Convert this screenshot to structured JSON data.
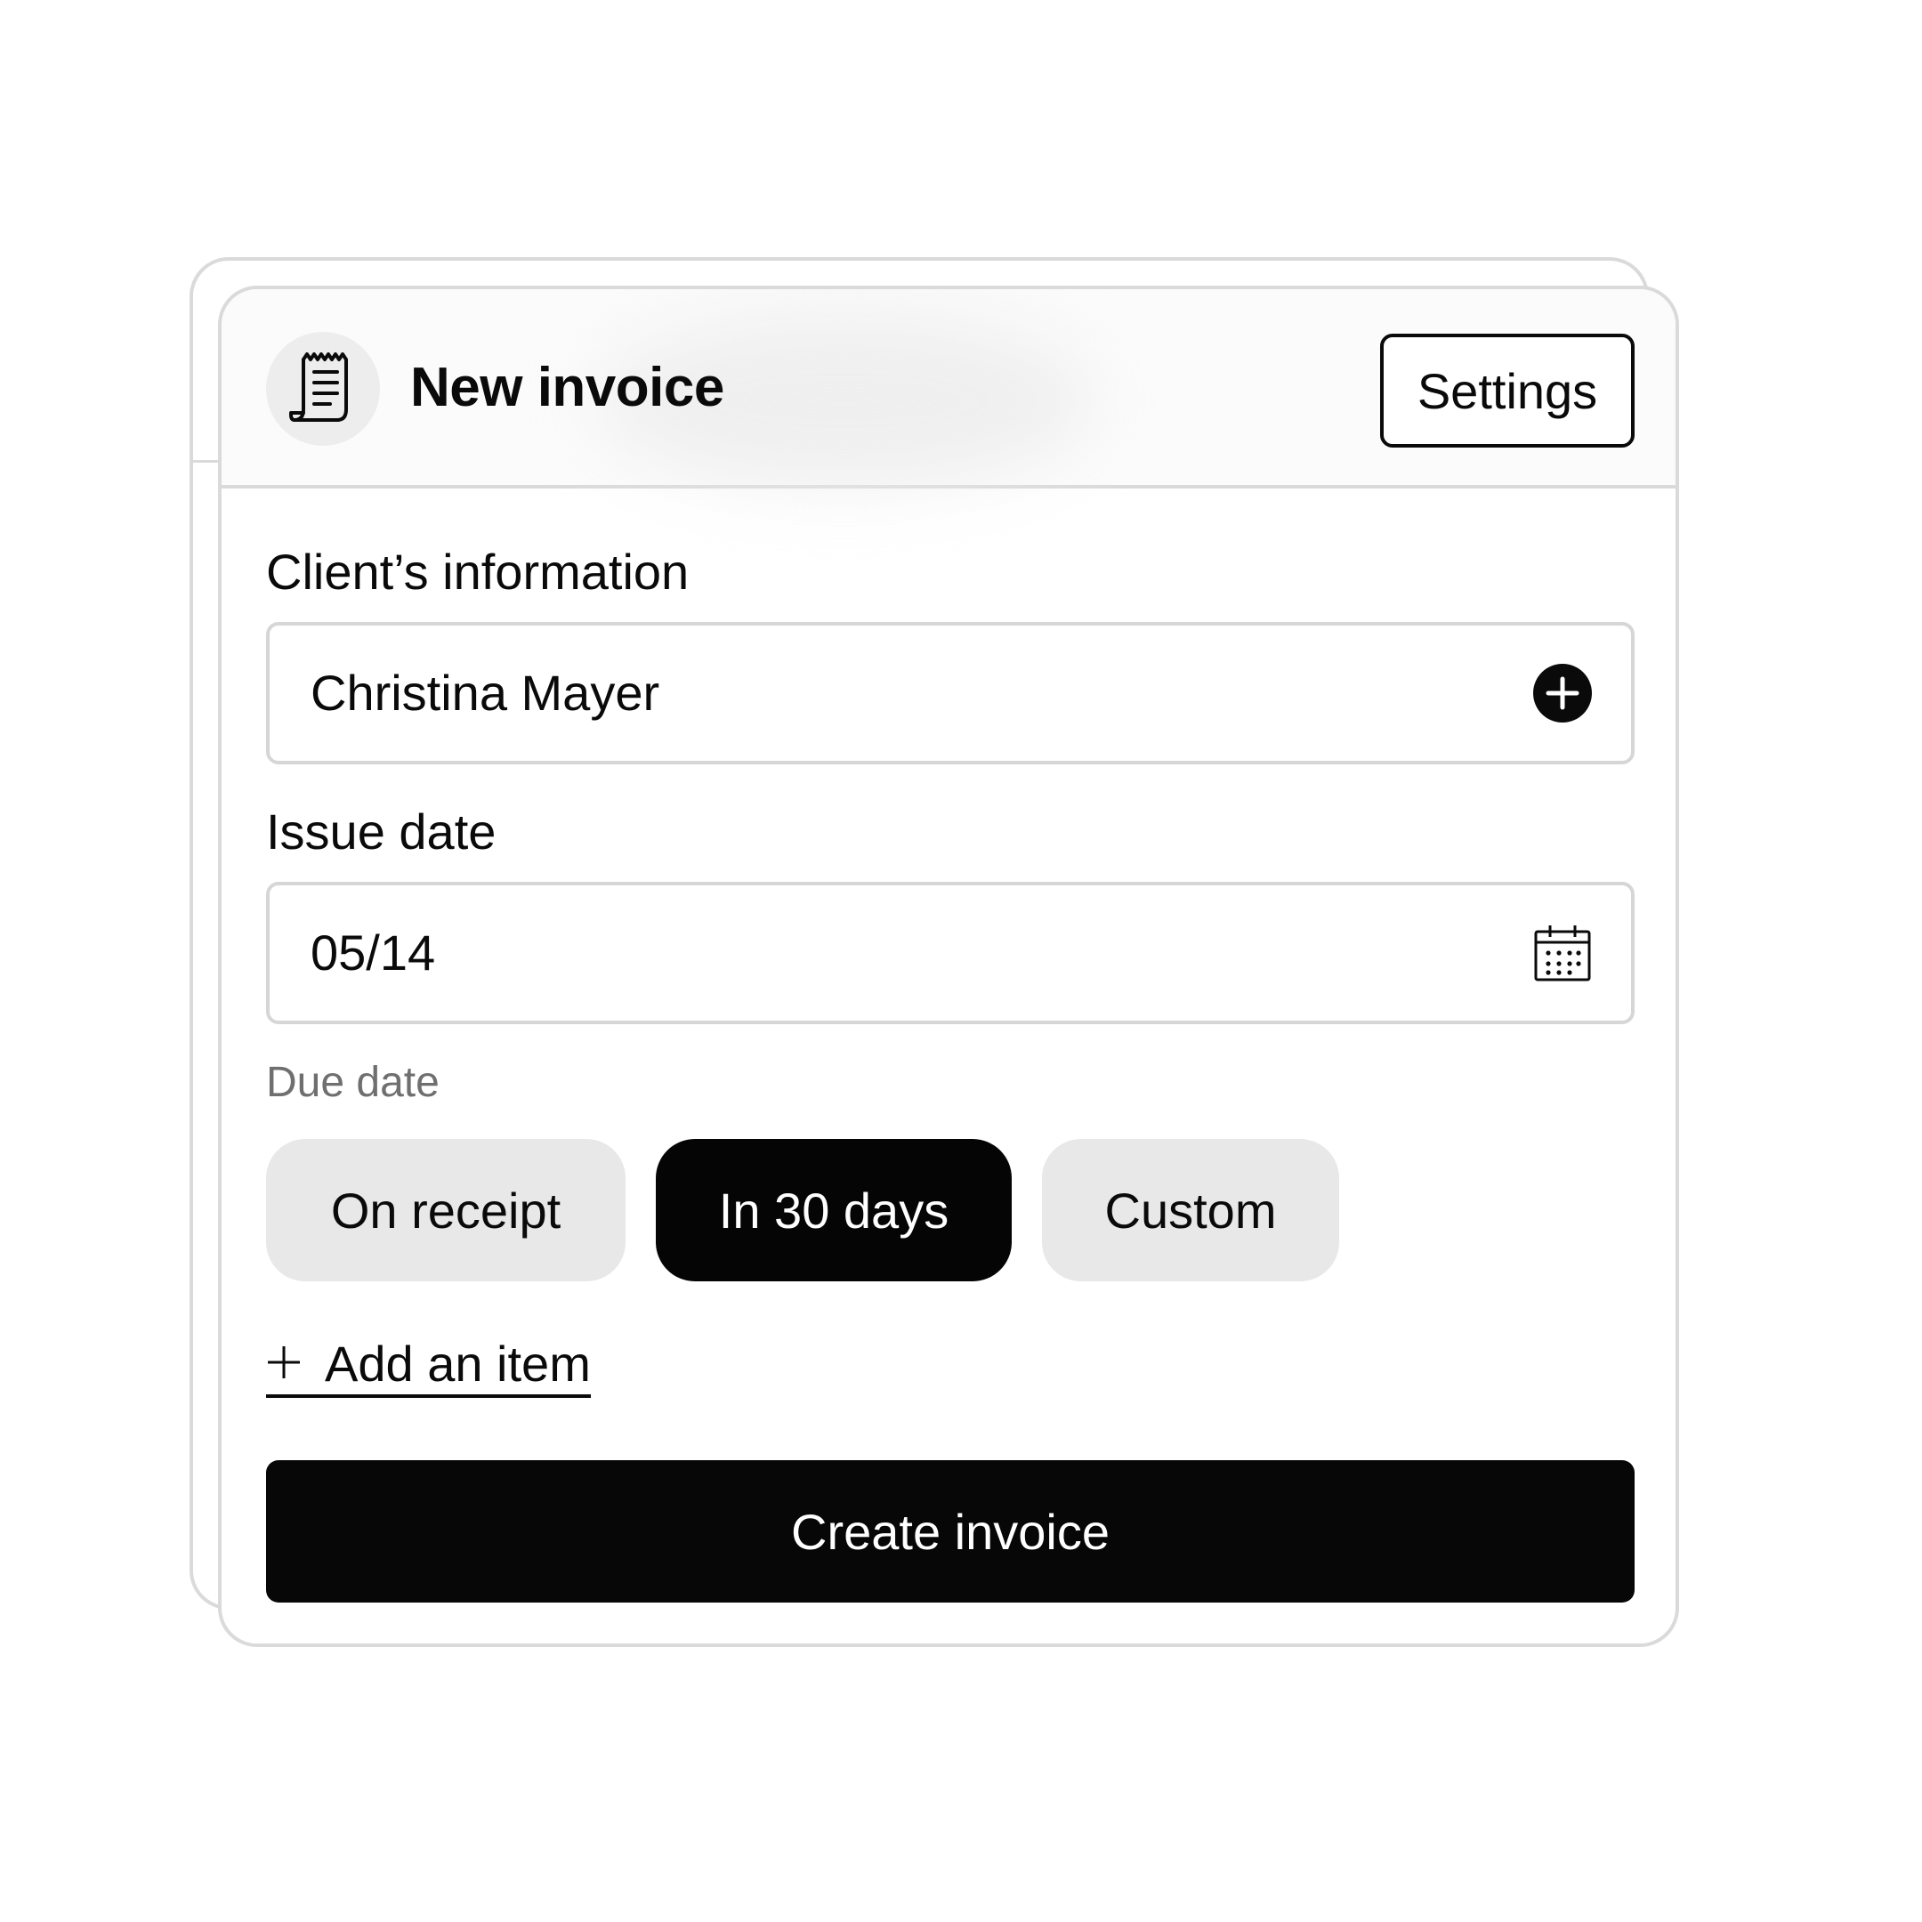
{
  "header": {
    "title": "New invoice",
    "icon": "receipt-icon",
    "settings_label": "Settings"
  },
  "client": {
    "label": "Client’s information",
    "value": "Christina Mayer",
    "action_icon": "plus-circle-icon"
  },
  "issue_date": {
    "label": "Issue date",
    "value": "05/14",
    "action_icon": "calendar-icon"
  },
  "due_date": {
    "label": "Due date",
    "options": [
      "On receipt",
      "In 30 days",
      "Custom"
    ],
    "selected": "In 30 days"
  },
  "add_item": {
    "label": "Add an item",
    "icon": "plus-icon"
  },
  "submit": {
    "label": "Create invoice"
  },
  "colors": {
    "primary": "#070707",
    "chip_bg": "#e8e8e8",
    "border": "#dadada",
    "muted_text": "#6f6f6f"
  }
}
